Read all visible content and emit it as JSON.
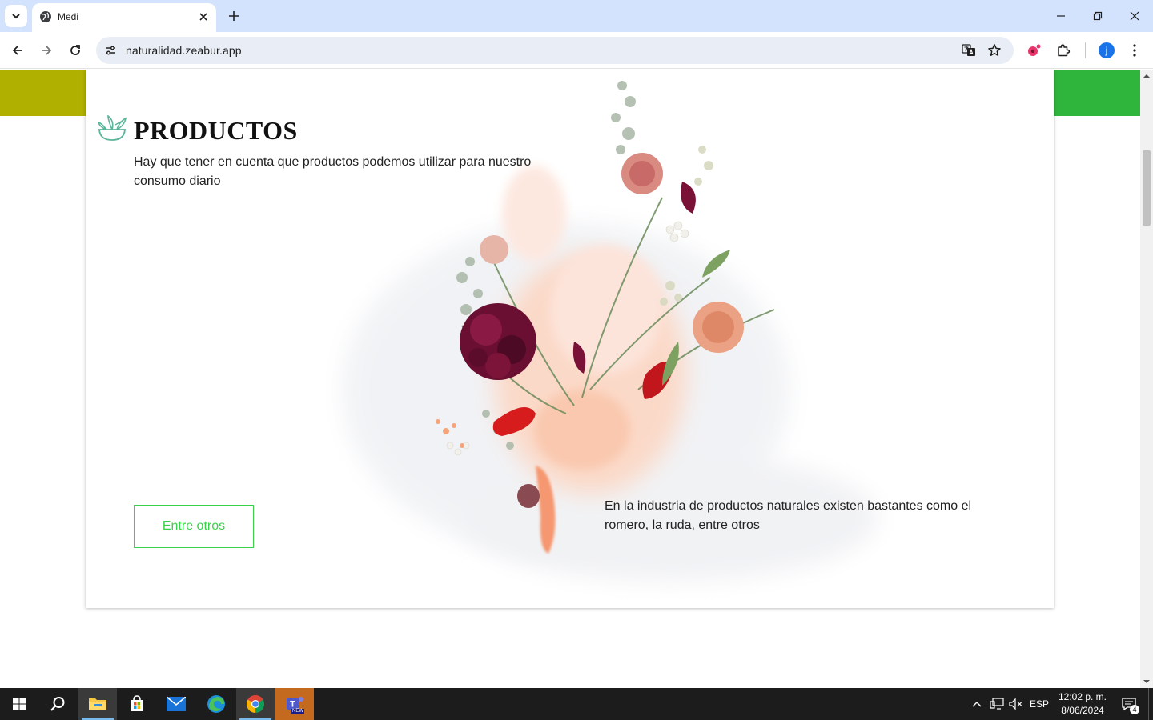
{
  "browser": {
    "tab_title": "Medi",
    "url": "naturalidad.zeabur.app",
    "profile_initial": "j"
  },
  "page": {
    "title": "PRODUCTOS",
    "description": "Hay que tener en cuenta que productos podemos utilizar para nuestro consumo diario",
    "button_label": "Entre otros",
    "secondary_text": "En la industria de productos naturales existen bastantes como el romero, la ruda, entre otros"
  },
  "colors": {
    "band_left": "#b0b000",
    "band_right": "#2fb43c",
    "accent_green": "#3ad14a"
  },
  "taskbar": {
    "language": "ESP",
    "time": "12:02 p. m.",
    "date": "8/06/2024",
    "notification_count": "4",
    "teams_badge": "NEW"
  }
}
